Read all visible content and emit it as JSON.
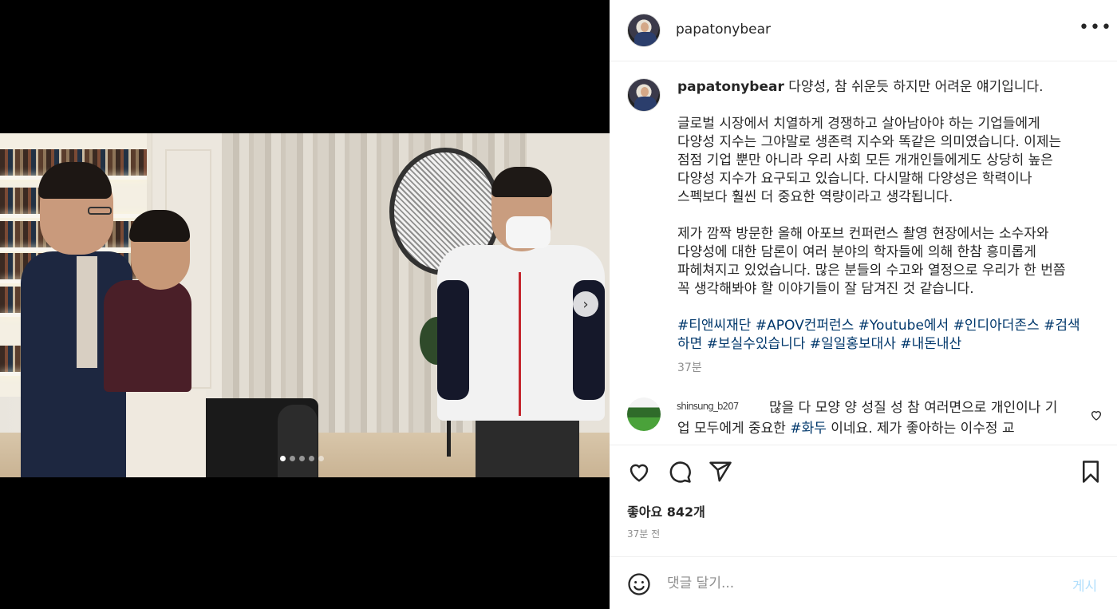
{
  "post": {
    "username": "papatonybear",
    "more_label": "•••",
    "caption": {
      "username": "papatonybear",
      "first_line": "다양성, 참 쉬운듯 하지만 어려운 얘기입니다.",
      "paragraph1": "글로벌 시장에서 치열하게 경쟁하고 살아남아야 하는 기업들에게 다양성 지수는 그야말로 생존력 지수와 똑같은 의미였습니다. 이제는 점점 기업 뿐만 아니라 우리 사회 모든 개개인들에게도 상당히 높은 다양성 지수가 요구되고 있습니다. 다시말해 다양성은 학력이나 스펙보다 훨씬 더 중요한 역량이라고 생각됩니다.",
      "paragraph2": "제가 깜짝 방문한 올해 아포브 컨퍼런스 촬영 현장에서는 소수자와 다양성에 대한 담론이 여러 분야의 학자들에 의해 한참 흥미롭게 파헤쳐지고 있었습니다. 많은 분들의 수고와 열정으로 우리가 한 번쯤 꼭 생각해봐야 할 이야기들이 잘 담겨진 것 같습니다.",
      "hashtags": [
        "#티앤씨재단",
        "#APOV컨퍼런스",
        "#Youtube에서",
        "#인디아더존스",
        "#검색하면",
        "#보실수있습니다",
        "#일일홍보대사",
        "#내돈내산"
      ],
      "time": "37분"
    },
    "comment": {
      "username": "shinsung_b207",
      "text_before": "많을 다 모양 양 성질 성 참 여러면으로 개인이나 기업 모두에게 중요한 ",
      "tag": "#화두",
      "text_after": " 이네요. 제가 좋아하는 이수정 교"
    },
    "likes": "좋아요 842개",
    "posted_ago": "37분 전",
    "add_comment": {
      "placeholder": "댓글 달기...",
      "post_label": "게시"
    },
    "carousel": {
      "next_label": "›",
      "dot_count": 5,
      "active_index": 0
    }
  },
  "icons": {
    "like": "heart-icon",
    "comment": "comment-bubble-icon",
    "share": "paper-plane-icon",
    "save": "bookmark-icon",
    "emoji": "smiley-icon"
  },
  "colors": {
    "link": "#00376b",
    "muted": "#8e8e8e",
    "post_button_disabled": "#b2dffc"
  }
}
